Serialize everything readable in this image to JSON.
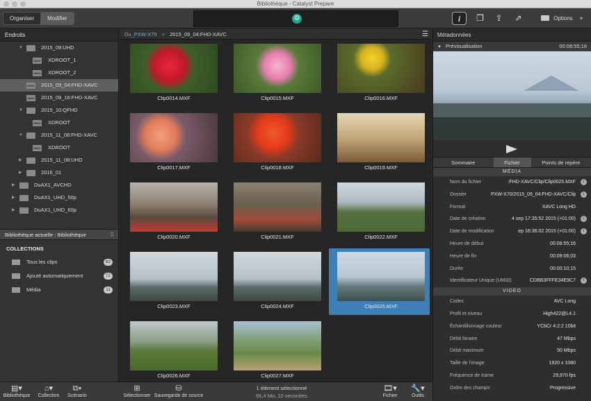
{
  "window": {
    "title": "Bibliothèque - Catalyst Prepare"
  },
  "toolbar": {
    "mode_organiser": "Organiser",
    "mode_modifier": "Modifier",
    "options_label": "Options",
    "options_caret": "▾"
  },
  "left": {
    "places_title": "Endroits",
    "tree": [
      {
        "label": "2015_09:UHD",
        "type": "folder",
        "expand": "▼"
      },
      {
        "label": "XDROOT_1",
        "type": "xavc",
        "expand": ""
      },
      {
        "label": "XDROOT_2",
        "type": "xavc",
        "expand": ""
      },
      {
        "label": "2015_09_04:FHD-XAVC",
        "type": "xavc",
        "expand": ""
      },
      {
        "label": "2015_09_16:FHD-XAVC",
        "type": "xavc",
        "expand": ""
      },
      {
        "label": "2015_10:QFHD",
        "type": "folder",
        "expand": "▼"
      },
      {
        "label": "XDROOT",
        "type": "xavc",
        "expand": ""
      },
      {
        "label": "2015_11_08:FHD-XAVC",
        "type": "folder",
        "expand": "▼"
      },
      {
        "label": "XDROOT",
        "type": "xavc",
        "expand": ""
      },
      {
        "label": "2015_11_08:UHD",
        "type": "folder",
        "expand": "▶"
      },
      {
        "label": "2016_01",
        "type": "folder",
        "expand": "▶"
      },
      {
        "label": "DuAX1_AVCHD",
        "type": "folder",
        "expand": "▶"
      },
      {
        "label": "DuAX1_UHD_50p",
        "type": "folder",
        "expand": "▶"
      },
      {
        "label": "DuAX1_UHD_60p",
        "type": "folder",
        "expand": "▶"
      }
    ],
    "xavc_badge": "XAVC",
    "library_title": "Bibliothèque actuelle : Bibliothèque",
    "collections_title": "COLLECTIONS",
    "collections": [
      {
        "label": "Tous les clips",
        "count": "83"
      },
      {
        "label": "Ajouté automatiquement",
        "count": "72"
      },
      {
        "label": "Média",
        "count": "11"
      }
    ]
  },
  "center": {
    "breadcrumb_root": "Du_PXW-X70",
    "breadcrumb_sep": ">",
    "breadcrumb_current": "2015_09_04:FHD-XAVC",
    "clips": [
      {
        "name": "Clip0014.MXF"
      },
      {
        "name": "Clip0015.MXF"
      },
      {
        "name": "Clip0016.MXF"
      },
      {
        "name": "Clip0017.MXF"
      },
      {
        "name": "Clip0018.MXF"
      },
      {
        "name": "Clip0019.MXF"
      },
      {
        "name": "Clip0020.MXF"
      },
      {
        "name": "Clip0021.MXF"
      },
      {
        "name": "Clip0022.MXF"
      },
      {
        "name": "Clip0023.MXF"
      },
      {
        "name": "Clip0024.MXF"
      },
      {
        "name": "Clip0025.MXF"
      },
      {
        "name": "Clip0026.MXF"
      },
      {
        "name": "Clip0027.MXF"
      }
    ]
  },
  "bottom": {
    "bibliotheque": "Bibliothèque",
    "collection": "Collection",
    "scenario": "Scénario",
    "selectionner": "Sélectionner",
    "sauvegarde": "Sauvegarde de source",
    "status_line1": "1 élément sélectionné",
    "status_line2": "66,4 Mo, 10 secondes",
    "fichier": "Fichier",
    "outils": "Outils"
  },
  "right": {
    "title": "Métadonnées",
    "preview_label": "Prévisualisation",
    "preview_duration": "00:08:55;16",
    "tabs": [
      "Sommaire",
      "Fichier",
      "Points de repère"
    ],
    "media_group": "MÉDIA",
    "media": [
      {
        "k": "Nom du fichier",
        "v": ":FHD-XAVC/Clip/Clip0025.MXF",
        "info": true
      },
      {
        "k": "Dossier",
        "v": "PXW-X70/2015_09_04:FHD-XAVC/Clip",
        "info": true
      },
      {
        "k": "Format",
        "v": "XAVC Long HD",
        "info": false
      },
      {
        "k": "Date de création",
        "v": "4 sep 17:35:52 2015 (+01:00)",
        "info": true
      },
      {
        "k": "Date de modification",
        "v": "ep 16:36:02 2015 (+01:00)",
        "info": true
      },
      {
        "k": "Heure de début",
        "v": "00:08:55;16",
        "info": false
      },
      {
        "k": "Heure de fin",
        "v": "00:09:06;03",
        "info": false
      },
      {
        "k": "Durée",
        "v": "00:00:10;15",
        "info": false
      },
      {
        "k": "Identificateur Unique (UMID)",
        "v": "CDBB3FFFE34E9C7",
        "info": true
      }
    ],
    "video_group": "VIDÉO",
    "video": [
      {
        "k": "Codec",
        "v": "AVC Long"
      },
      {
        "k": "Profil et niveau",
        "v": "High422@L4.1"
      },
      {
        "k": "Échantillonnage couleur",
        "v": "YCbCr 4:2:2 10bit"
      },
      {
        "k": "Débit binaire",
        "v": "47 Mbps"
      },
      {
        "k": "Débit maximum",
        "v": "50 Mbps"
      },
      {
        "k": "Taille de l'image",
        "v": "1920 x 1080"
      },
      {
        "k": "Fréquence de trame",
        "v": "29,970 fps"
      },
      {
        "k": "Ordre des champs",
        "v": "Progressive"
      }
    ]
  }
}
